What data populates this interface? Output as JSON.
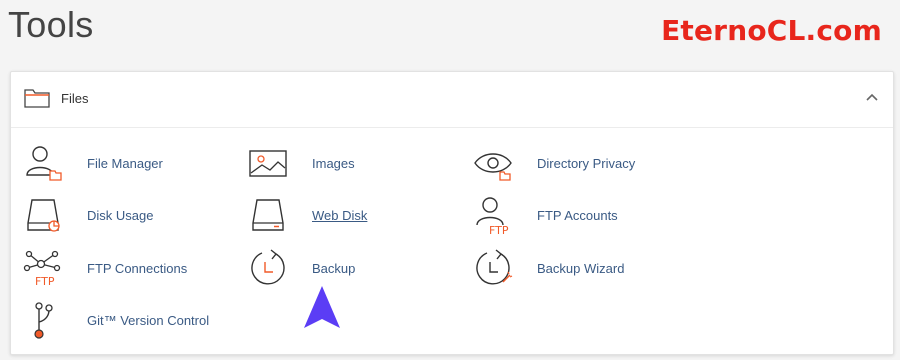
{
  "page": {
    "title": "Tools"
  },
  "watermark": {
    "text": "EternoCL.com"
  },
  "panel": {
    "title": "Files",
    "items": [
      {
        "label": "File Manager",
        "icon": "file-manager-icon"
      },
      {
        "label": "Images",
        "icon": "images-icon"
      },
      {
        "label": "Directory Privacy",
        "icon": "directory-privacy-icon"
      },
      {
        "label": "Disk Usage",
        "icon": "disk-usage-icon"
      },
      {
        "label": "Web Disk",
        "icon": "web-disk-icon",
        "hovered": true
      },
      {
        "label": "FTP Accounts",
        "icon": "ftp-accounts-icon",
        "badge": "FTP"
      },
      {
        "label": "FTP Connections",
        "icon": "ftp-connections-icon",
        "badge": "FTP"
      },
      {
        "label": "Backup",
        "icon": "backup-icon"
      },
      {
        "label": "Backup Wizard",
        "icon": "backup-wizard-icon"
      },
      {
        "label": "Git™ Version Control",
        "icon": "git-icon"
      }
    ]
  },
  "colors": {
    "accent": "#f15a29",
    "link": "#3a5a84",
    "watermark": "#e8261c",
    "pointer": "#5b3df5"
  }
}
